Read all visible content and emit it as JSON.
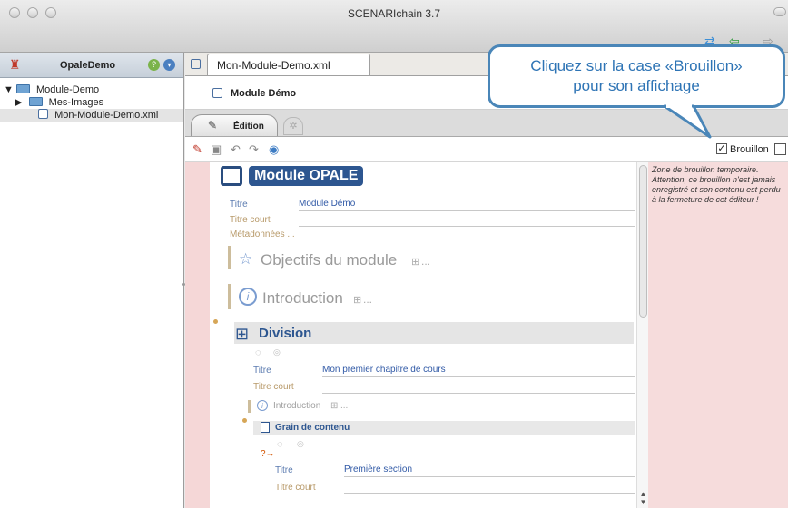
{
  "window": {
    "title": "SCENARIchain 3.7"
  },
  "left_panel": {
    "workspace": "OpaleDemo",
    "tree": [
      {
        "label": "Module-Demo"
      },
      {
        "label": "Mes-Images"
      },
      {
        "label": "Mon-Module-Demo.xml"
      }
    ]
  },
  "editor": {
    "tab_label": "Mon-Module-Demo.xml",
    "doc_title": "Module Démo",
    "subtab_label": "Édition",
    "brouillon_label": "Brouillon",
    "brouillon_checked": true,
    "draft_text": "Zone de brouillon temporaire. Attention, ce brouillon n'est jamais enregistré et son contenu est perdu à la fermeture de cet éditeur !"
  },
  "content": {
    "module_title": "Module OPALE",
    "titre_label": "Titre",
    "titre_value": "Module Démo",
    "titre_court_label": "Titre court",
    "metadonnees_label": "Métadonnées ...",
    "objectifs": "Objectifs du module",
    "objectifs_suffix": "...",
    "introduction": "Introduction",
    "introduction_suffix": "...",
    "division": "Division",
    "division_titre_label": "Titre",
    "division_titre_value": "Mon premier chapitre de cours",
    "division_titre_court_label": "Titre court",
    "division_intro": "Introduction",
    "division_intro_suffix": "...",
    "grain": "Grain de contenu",
    "grain_titre_label": "Titre",
    "grain_titre_value": "Première section",
    "grain_titre_court_label": "Titre court"
  },
  "callout": {
    "line1": "Cliquez sur la case «Brouillon»",
    "line2": "pour son affichage"
  },
  "colors": {
    "accent": "#2d5690",
    "callout_border": "#4a86b8",
    "draft_bg": "#f6dcdc"
  }
}
